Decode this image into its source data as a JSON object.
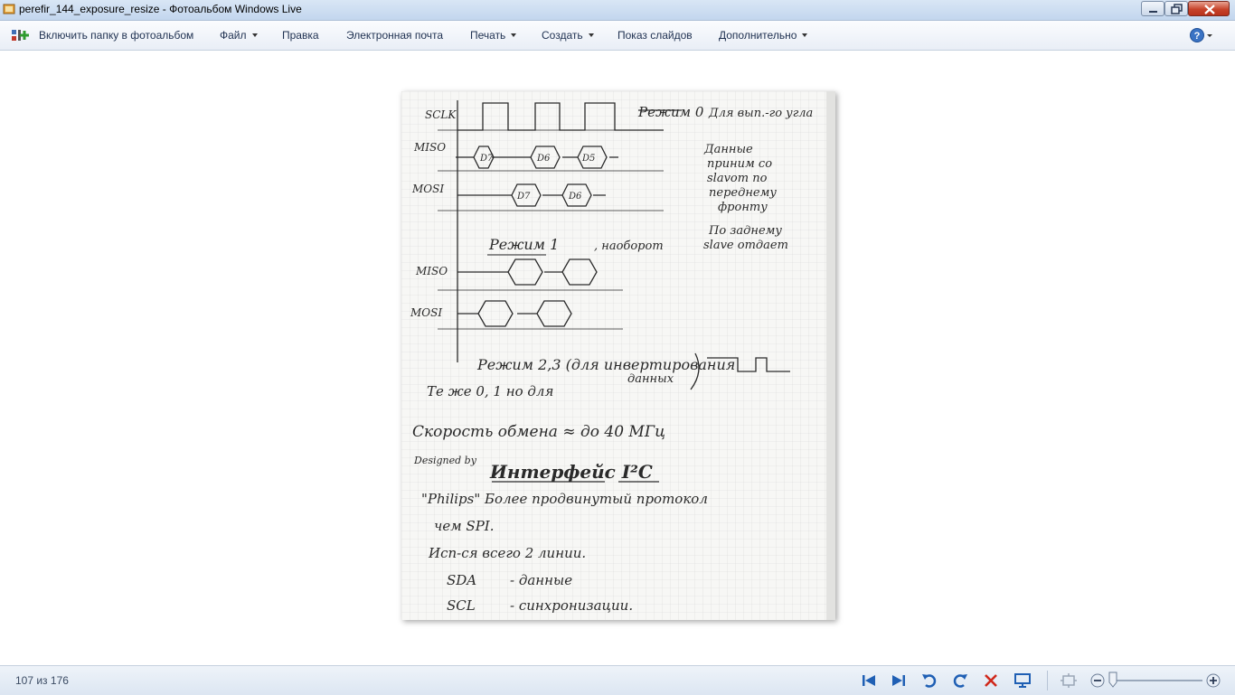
{
  "window": {
    "title": "perefir_144_exposure_resize - Фотоальбом Windows Live"
  },
  "menubar": {
    "include_folder": "Включить папку в фотоальбом",
    "items": [
      {
        "label": "Файл",
        "dropdown": true
      },
      {
        "label": "Правка",
        "dropdown": false
      },
      {
        "label": "Электронная почта",
        "dropdown": false
      },
      {
        "label": "Печать",
        "dropdown": true
      },
      {
        "label": "Создать",
        "dropdown": true
      },
      {
        "label": "Показ слайдов",
        "dropdown": false
      },
      {
        "label": "Дополнительно",
        "dropdown": true
      }
    ],
    "help_icon": "help-icon"
  },
  "photo": {
    "notes": {
      "sclk": "SCLK",
      "miso": "MISO",
      "mosi": "MOSI",
      "d7": "D7",
      "d6": "D6",
      "d5": "D5",
      "mode0": "Режим 0",
      "mode0_note": "Для вып.-го угла",
      "data_note_1": "Данные",
      "data_note_2": "приним со",
      "data_note_3": "slavom по",
      "data_note_4": "переднему",
      "data_note_5": "фронту",
      "slave_note_1": "По заднему",
      "slave_note_2": "slave отдает",
      "mode1": "Режим 1",
      "mode1_note": ", наоборот",
      "mode23": "Режим 2,3 (для инвертирования",
      "same_note": "Те же 0, 1 но для",
      "same_note_2": "данных",
      "speed": "Скорость обмена ≈ до 40 МГц",
      "designed": "Designed by",
      "i2c_title": "Интерфейс I²C",
      "philips": "\"Philips\"  Более продвинутый протокол",
      "than_spi": "чем SPI.",
      "uses": "Исп-ся всего 2 линии.",
      "sda": "SDA",
      "sda_desc": "- данные",
      "scl": "SCL",
      "scl_desc": "- синхронизации."
    }
  },
  "statusbar": {
    "counter": "107 из 176",
    "icons": [
      "previous-icon",
      "next-icon",
      "rotate-left-icon",
      "rotate-right-icon",
      "delete-icon",
      "slideshow-icon",
      "actual-size-icon",
      "zoom-out-icon",
      "zoom-in-icon"
    ],
    "zoom_level": 0
  }
}
